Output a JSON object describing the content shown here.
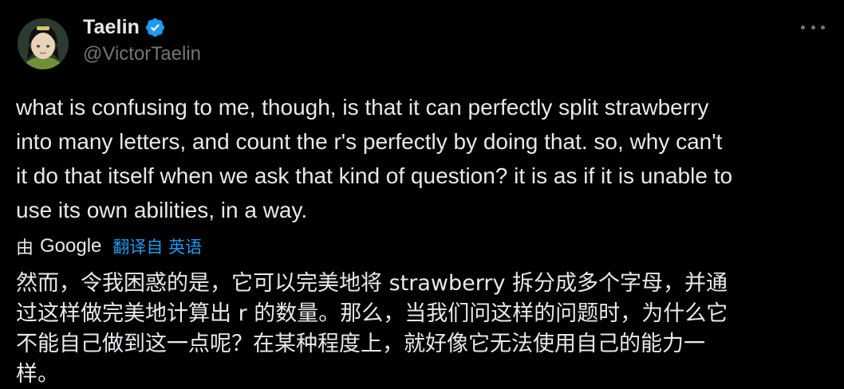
{
  "author": {
    "display_name": "Taelin",
    "handle": "@VictorTaelin",
    "verified": true,
    "avatar_icon": "avatar-icon"
  },
  "menu_icon": "more-horizontal-icon",
  "colors": {
    "background": "#000000",
    "text": "#e7e9ea",
    "secondary": "#71767b",
    "accent": "#1d9bf0"
  },
  "tweet": {
    "text": "what is confusing to me, though, is that it can perfectly split strawberry\ninto many letters, and count the r's perfectly by doing that. so, why can't\nit do that itself when we ask that kind of question? it is as if it is unable to\nuse its own abilities, in a way.",
    "translation_prefix": "由",
    "translation_provider": "Google",
    "translation_link": "翻译自 英语",
    "translated_text": "然而，令我困惑的是，它可以完美地将 strawberry 拆分成多个字母，并通\n过这样做完美地计算出 r 的数量。那么，当我们问这样的问题时，为什么它\n不能自己做到这一点呢？在某种程度上，就好像它无法使用自己的能力一\n样。"
  }
}
